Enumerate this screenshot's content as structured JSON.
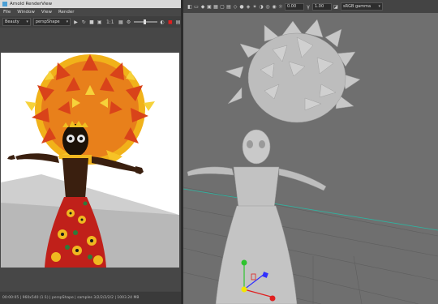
{
  "render_view": {
    "title": "Arnold RenderView",
    "menu": [
      "File",
      "Window",
      "View",
      "Render"
    ],
    "toolbar": {
      "aov_value": "Beauty",
      "camera_value": "perspShape",
      "zoom_label": "1:1"
    },
    "status_text": "00:00:05 | 960x540 (1:1) | perspShape | samples 3/2/2/2/2/2 | 1003.24 MB"
  },
  "viewport": {
    "toolbar": {
      "exposure_value": "0.00",
      "gamma_value": "1.00",
      "color_space_value": "sRGB gamma"
    }
  },
  "colors": {
    "maya_accent": "#4b9fd5",
    "manip_green": "#2ec42e",
    "manip_yellow": "#f2e600",
    "manip_red": "#e02020",
    "manip_blue": "#3030ff",
    "grid_axis": "#2fb3a0"
  }
}
